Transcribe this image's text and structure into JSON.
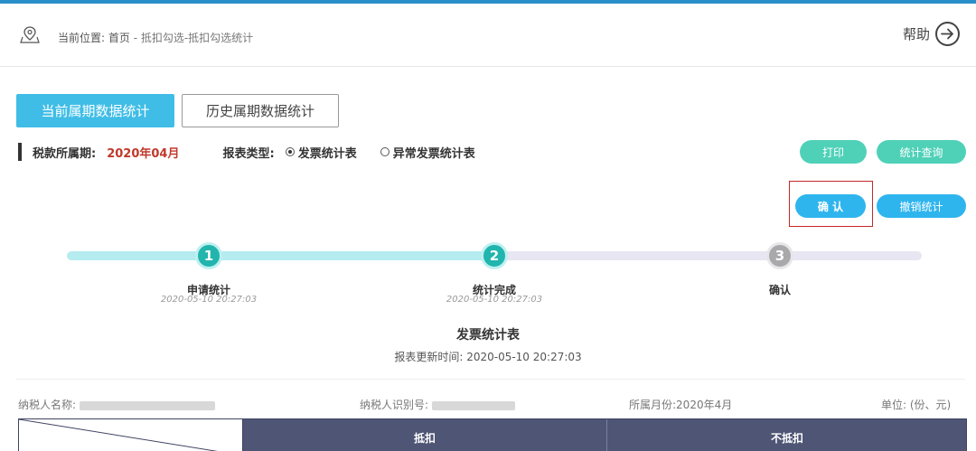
{
  "header": {
    "location_label": "当前位置:",
    "breadcrumb_home": "首页",
    "breadcrumb_path": " - 抵扣勾选-抵扣勾选统计",
    "help_label": "帮助"
  },
  "tabs": [
    {
      "label": "当前属期数据统计",
      "active": true
    },
    {
      "label": "历史属期数据统计",
      "active": false
    }
  ],
  "info": {
    "period_label": "税款所属期:",
    "period_value": "2020年04月",
    "report_type_label": "报表类型:",
    "report_types": [
      {
        "label": "发票统计表",
        "selected": true
      },
      {
        "label": "异常发票统计表",
        "selected": false
      }
    ]
  },
  "actions": {
    "print": "打印",
    "query": "统计查询",
    "confirm": "确 认",
    "revoke": "撤销统计"
  },
  "progress": {
    "steps": [
      {
        "number": "1",
        "label": "申请统计",
        "time": "2020-05-10 20:27:03",
        "status": "done"
      },
      {
        "number": "2",
        "label": "统计完成",
        "time": "2020-05-10 20:27:03",
        "status": "done"
      },
      {
        "number": "3",
        "label": "确认",
        "time": "",
        "status": "pending"
      }
    ]
  },
  "report": {
    "title": "发票统计表",
    "update_label": "报表更新时间:",
    "update_time": "2020-05-10 20:27:03"
  },
  "meta": {
    "taxpayer_name_label": "纳税人名称:",
    "taxpayer_id_label": "纳税人识别号:",
    "month_label": "所属月份:",
    "month_value": "2020年4月",
    "unit_label": "单位:",
    "unit_value": "(份、元)"
  },
  "table": {
    "headers": [
      "抵扣",
      "不抵扣"
    ]
  },
  "colors": {
    "accent": "#3fbde6",
    "teal": "#4fd1b8",
    "period": "#c0392b",
    "table_header": "#4e5575"
  }
}
